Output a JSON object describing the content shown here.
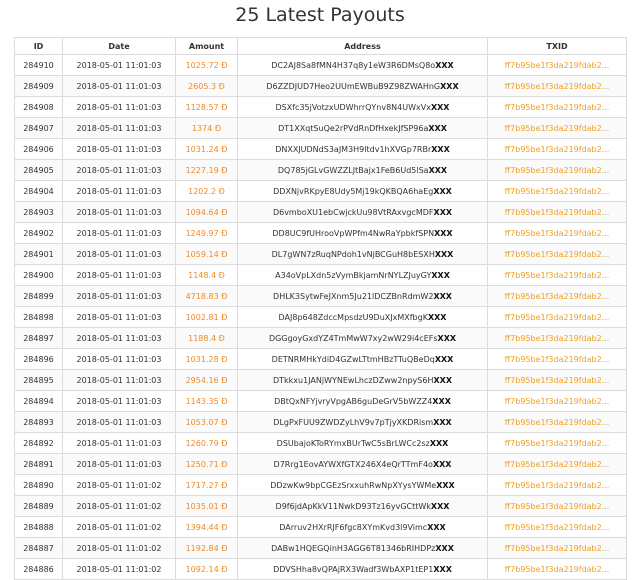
{
  "page": {
    "title": "25 Latest Payouts"
  },
  "table": {
    "headers": [
      "ID",
      "Date",
      "Amount",
      "Address",
      "TXID"
    ],
    "currency_symbol": "Đ",
    "rows": [
      {
        "id": "284910",
        "date": "2018-05-01 11:01:03",
        "amount": "1025.72 Đ",
        "address": "DC2AJ8Sa8fMN4H37q8y1eW3R6DMsQ8o",
        "address_suffix": "XXX",
        "txid": "ff7b95be1f3da219fdab2..."
      },
      {
        "id": "284909",
        "date": "2018-05-01 11:01:03",
        "amount": "2605.3 Đ",
        "address": "D6ZZDJUD7Heo2UUmEWBuB9Z98ZWAHnG",
        "address_suffix": "XXX",
        "txid": "ff7b95be1f3da219fdab2..."
      },
      {
        "id": "284908",
        "date": "2018-05-01 11:01:03",
        "amount": "1128.57 Đ",
        "address": "DSXfc35jVotzxUDWhrrQYnv8N4UWxVx",
        "address_suffix": "XXX",
        "txid": "ff7b95be1f3da219fdab2..."
      },
      {
        "id": "284907",
        "date": "2018-05-01 11:01:03",
        "amount": "1374 Đ",
        "address": "DT1XXqtSuQe2rPVdRnDfHxekJfSP96a",
        "address_suffix": "XXX",
        "txid": "ff7b95be1f3da219fdab2..."
      },
      {
        "id": "284906",
        "date": "2018-05-01 11:01:03",
        "amount": "1031.24 Đ",
        "address": "DNXXJUDNdS3aJM3H9ltdv1hXVGp7RBr",
        "address_suffix": "XXX",
        "txid": "ff7b95be1f3da219fdab2..."
      },
      {
        "id": "284905",
        "date": "2018-05-01 11:01:03",
        "amount": "1227.19 Đ",
        "address": "DQ785jGLvGWZZLJtBajx1FeB6Ud5lSa",
        "address_suffix": "XXX",
        "txid": "ff7b95be1f3da219fdab2..."
      },
      {
        "id": "284904",
        "date": "2018-05-01 11:01:03",
        "amount": "1202.2 Đ",
        "address": "DDXNjvRKpyE8Udy5Mj19kQKBQA6haEg",
        "address_suffix": "XXX",
        "txid": "ff7b95be1f3da219fdab2..."
      },
      {
        "id": "284903",
        "date": "2018-05-01 11:01:03",
        "amount": "1094.64 Đ",
        "address": "D6vmboXU1ebCwjckUu98VtRAxvgcMDF",
        "address_suffix": "XXX",
        "txid": "ff7b95be1f3da219fdab2..."
      },
      {
        "id": "284902",
        "date": "2018-05-01 11:01:03",
        "amount": "1249.97 Đ",
        "address": "DD8UC9fUHrooVpWPfm4NwRaYpbkfSPN",
        "address_suffix": "XXX",
        "txid": "ff7b95be1f3da219fdab2..."
      },
      {
        "id": "284901",
        "date": "2018-05-01 11:01:03",
        "amount": "1059.14 Đ",
        "address": "DL7gWN7zRuqNPdoh1vNjBCGuH8bESXH",
        "address_suffix": "XXX",
        "txid": "ff7b95be1f3da219fdab2..."
      },
      {
        "id": "284900",
        "date": "2018-05-01 11:01:03",
        "amount": "1148.4 Đ",
        "address": "A34oVpLXdn5zVymBkjamNrNYLZJuyGY",
        "address_suffix": "XXX",
        "txid": "ff7b95be1f3da219fdab2..."
      },
      {
        "id": "284899",
        "date": "2018-05-01 11:01:03",
        "amount": "4718.83 Đ",
        "address": "DHLK3SytwFeJXnm5Ju21lDCZBnRdmW2",
        "address_suffix": "XXX",
        "txid": "ff7b95be1f3da219fdab2..."
      },
      {
        "id": "284898",
        "date": "2018-05-01 11:01:03",
        "amount": "1002.81 Đ",
        "address": "DAJ8p648ZdccMpsdzU9DuXJxMXfbgK",
        "address_suffix": "XXX",
        "txid": "ff7b95be1f3da219fdab2..."
      },
      {
        "id": "284897",
        "date": "2018-05-01 11:01:03",
        "amount": "1188.4 Đ",
        "address": "DGGgoyGxdYZ4TmMwW7xy2wW29i4cEFs",
        "address_suffix": "XXX",
        "txid": "ff7b95be1f3da219fdab2..."
      },
      {
        "id": "284896",
        "date": "2018-05-01 11:01:03",
        "amount": "1031.28 Đ",
        "address": "DETNRMHkYdiD4GZwLTtmHBzTTuQBeDq",
        "address_suffix": "XXX",
        "txid": "ff7b95be1f3da219fdab2..."
      },
      {
        "id": "284895",
        "date": "2018-05-01 11:01:03",
        "amount": "2954.16 Đ",
        "address": "DTkkxu1JANjWYNEwLhczDZww2npyS6H",
        "address_suffix": "XXX",
        "txid": "ff7b95be1f3da219fdab2..."
      },
      {
        "id": "284894",
        "date": "2018-05-01 11:01:03",
        "amount": "1143.35 Đ",
        "address": "DBtQxNFYjvryVpgAB6guDeGrV5bWZZ4",
        "address_suffix": "XXX",
        "txid": "ff7b95be1f3da219fdab2..."
      },
      {
        "id": "284893",
        "date": "2018-05-01 11:01:03",
        "amount": "1053.07 Đ",
        "address": "DLgPxFUU9ZWDZyLhV9v7pTjyXKDRism",
        "address_suffix": "XXX",
        "txid": "ff7b95be1f3da219fdab2..."
      },
      {
        "id": "284892",
        "date": "2018-05-01 11:01:03",
        "amount": "1260.79 Đ",
        "address": "DSUbajoKToRYmxBUrTwC5sBrLWCc2sz",
        "address_suffix": "XXX",
        "txid": "ff7b95be1f3da219fdab2..."
      },
      {
        "id": "284891",
        "date": "2018-05-01 11:01:03",
        "amount": "1250.71 Đ",
        "address": "D7Rrg1EovAYWXfGTX246X4eQrTTmF4o",
        "address_suffix": "XXX",
        "txid": "ff7b95be1f3da219fdab2..."
      },
      {
        "id": "284890",
        "date": "2018-05-01 11:01:02",
        "amount": "1717.27 Đ",
        "address": "DDzwKw9bpCGEzSrxxuhRwNpXYysYWMe",
        "address_suffix": "XXX",
        "txid": "ff7b95be1f3da219fdab2..."
      },
      {
        "id": "284889",
        "date": "2018-05-01 11:01:02",
        "amount": "1035.01 Đ",
        "address": "D9f6jdApKkV11NwkD93Tz16yvGCttWk",
        "address_suffix": "XXX",
        "txid": "ff7b95be1f3da219fdab2..."
      },
      {
        "id": "284888",
        "date": "2018-05-01 11:01:02",
        "amount": "1394.44 Đ",
        "address": "DArruv2HXrRJF6fgc8XYmKvd3l9Vimc",
        "address_suffix": "XXX",
        "txid": "ff7b95be1f3da219fdab2..."
      },
      {
        "id": "284887",
        "date": "2018-05-01 11:01:02",
        "amount": "1192.84 Đ",
        "address": "DABw1HQEGQinH3AGG6T81346bRIHDPz",
        "address_suffix": "XXX",
        "txid": "ff7b95be1f3da219fdab2..."
      },
      {
        "id": "284886",
        "date": "2018-05-01 11:01:02",
        "amount": "1092.14 Đ",
        "address": "DDVSHha8vQPAjRX3Wadf3WbAXP1tEP1",
        "address_suffix": "XXX",
        "txid": "ff7b95be1f3da219fdab2..."
      }
    ]
  },
  "colors": {
    "amount": "#f08a24",
    "txid_link": "#f0a020",
    "border": "#dcdcdc"
  }
}
